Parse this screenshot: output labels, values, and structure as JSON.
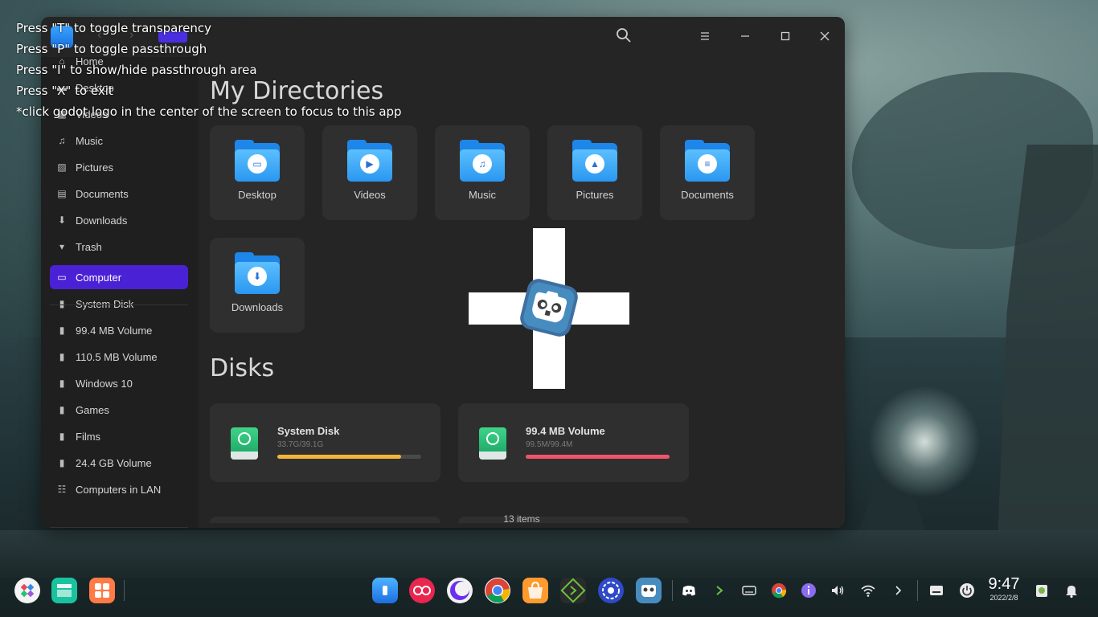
{
  "overlay": {
    "lines": [
      "Press \"T\" to toggle transparency",
      "Press \"P\" to toggle passthrough",
      "Press \"I\" to show/hide passthrough area",
      "Press \"X\" to exit",
      "*click godot logo in the center of the screen to focus to this app"
    ]
  },
  "titlebar": {
    "nav_back": "‹",
    "nav_forward": "›",
    "search_icon": "search-icon",
    "menu_icon": "menu-icon"
  },
  "sidebar": {
    "items": [
      {
        "label": "Home",
        "icon": "home-icon"
      },
      {
        "label": "Desktop",
        "icon": "desktop-icon"
      },
      {
        "label": "Videos",
        "icon": "videos-icon"
      },
      {
        "label": "Music",
        "icon": "music-icon"
      },
      {
        "label": "Pictures",
        "icon": "pictures-icon"
      },
      {
        "label": "Documents",
        "icon": "documents-icon"
      },
      {
        "label": "Downloads",
        "icon": "downloads-icon"
      },
      {
        "label": "Trash",
        "icon": "trash-icon"
      },
      {
        "label": "Computer",
        "icon": "computer-icon",
        "active": true
      },
      {
        "label": "System Disk",
        "icon": "disk-icon"
      },
      {
        "label": "99.4 MB Volume",
        "icon": "disk-icon"
      },
      {
        "label": "110.5 MB Volume",
        "icon": "disk-icon"
      },
      {
        "label": "Windows 10",
        "icon": "disk-icon"
      },
      {
        "label": "Games",
        "icon": "disk-icon"
      },
      {
        "label": "Films",
        "icon": "disk-icon"
      },
      {
        "label": "24.4 GB Volume",
        "icon": "disk-icon"
      },
      {
        "label": "Computers in LAN",
        "icon": "network-icon"
      }
    ]
  },
  "main": {
    "directories_title": "My Directories",
    "directories": [
      {
        "label": "Desktop",
        "badge": "▭"
      },
      {
        "label": "Videos",
        "badge": "▶"
      },
      {
        "label": "Music",
        "badge": "♫"
      },
      {
        "label": "Pictures",
        "badge": "▲"
      },
      {
        "label": "Documents",
        "badge": "≡"
      },
      {
        "label": "Downloads",
        "badge": "⬇"
      }
    ],
    "disks_title": "Disks",
    "disks": [
      {
        "name": "System Disk",
        "usage": "33.7G/39.1G",
        "used_fraction": 0.862,
        "color": "#f2b53a"
      },
      {
        "name": "99.4 MB Volume",
        "usage": "99.5M/99.4M",
        "used_fraction": 1.0,
        "color": "#f0546a"
      }
    ]
  },
  "status": {
    "items": "13 items"
  },
  "taskbar": {
    "clock_time": "9:47",
    "clock_date": "2022/2/8"
  },
  "colors": {
    "accent": "#4b21d6",
    "window_bg": "#252525",
    "sidebar_bg": "#1f1f1f"
  }
}
